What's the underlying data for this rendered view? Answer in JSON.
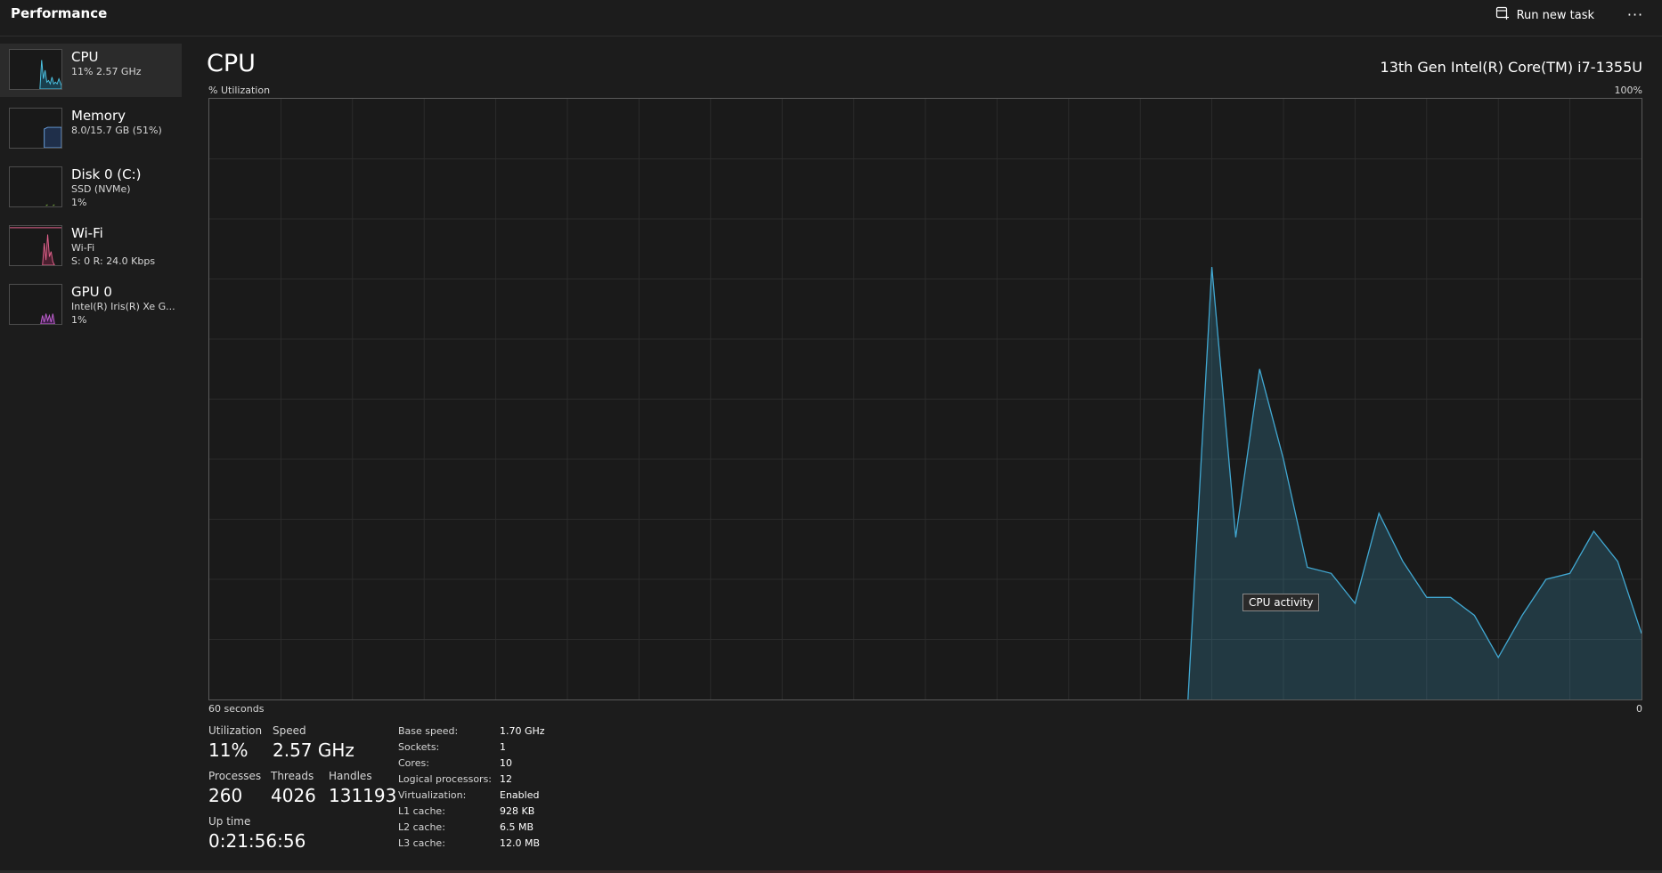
{
  "header": {
    "title": "Performance",
    "run_task_label": "Run new task",
    "more_label": "···"
  },
  "sidebar": {
    "items": [
      {
        "name": "CPU",
        "line1": "11% 2.57 GHz",
        "line2": "",
        "color": "#4cc2e2",
        "selected": true
      },
      {
        "name": "Memory",
        "line1": "8.0/15.7 GB (51%)",
        "line2": "",
        "color": "#6aa0e0",
        "selected": false
      },
      {
        "name": "Disk 0 (C:)",
        "line1": "SSD (NVMe)",
        "line2": "1%",
        "color": "#7cb342",
        "selected": false
      },
      {
        "name": "Wi-Fi",
        "line1": "Wi-Fi",
        "line2": "S: 0 R: 24.0 Kbps",
        "color": "#e0608a",
        "selected": false
      },
      {
        "name": "GPU 0",
        "line1": "Intel(R) Iris(R) Xe G...",
        "line2": "1%",
        "color": "#c060d0",
        "selected": false
      }
    ]
  },
  "main": {
    "title": "CPU",
    "model": "13th Gen Intel(R) Core(TM) i7-1355U",
    "tooltip": "CPU activity"
  },
  "chart_data": {
    "type": "area",
    "ylabel": "% Utilization",
    "y_max_label": "100%",
    "x_left_label": "60 seconds",
    "x_right_label": "0",
    "ylim": [
      0,
      100
    ],
    "xlim": [
      0,
      60
    ],
    "grid": true,
    "color": "#41a8d2",
    "x": [
      41,
      42,
      43,
      44,
      45,
      46,
      47,
      48,
      49,
      50,
      51,
      52,
      53,
      54,
      55,
      56,
      57,
      58,
      59,
      60
    ],
    "y": [
      0,
      72,
      27,
      55,
      40,
      22,
      21,
      16,
      31,
      23,
      17,
      17,
      14,
      7,
      14,
      20,
      21,
      28,
      23,
      11
    ]
  },
  "stats": {
    "utilization": {
      "label": "Utilization",
      "value": "11%"
    },
    "speed": {
      "label": "Speed",
      "value": "2.57 GHz"
    },
    "processes": {
      "label": "Processes",
      "value": "260"
    },
    "threads": {
      "label": "Threads",
      "value": "4026"
    },
    "handles": {
      "label": "Handles",
      "value": "131193"
    },
    "uptime": {
      "label": "Up time",
      "value": "0:21:56:56"
    }
  },
  "specs": [
    {
      "key": "Base speed:",
      "value": "1.70 GHz"
    },
    {
      "key": "Sockets:",
      "value": "1"
    },
    {
      "key": "Cores:",
      "value": "10"
    },
    {
      "key": "Logical processors:",
      "value": "12"
    },
    {
      "key": "Virtualization:",
      "value": "Enabled"
    },
    {
      "key": "L1 cache:",
      "value": "928 KB"
    },
    {
      "key": "L2 cache:",
      "value": "6.5 MB"
    },
    {
      "key": "L3 cache:",
      "value": "12.0 MB"
    }
  ]
}
